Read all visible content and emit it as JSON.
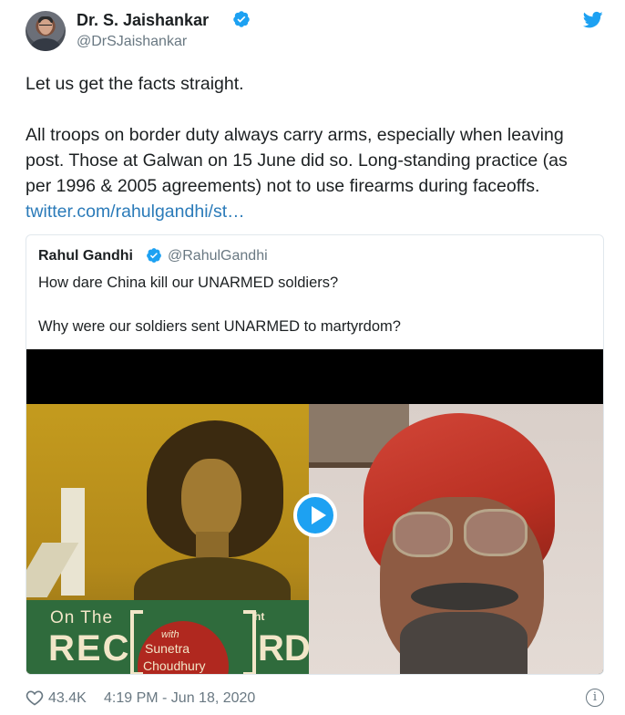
{
  "author": {
    "name": "Dr. S. Jaishankar",
    "handle": "@DrSJaishankar"
  },
  "tweet": {
    "line1": "Let us get the facts straight.",
    "line2": "All troops on border duty always carry arms, especially when leaving",
    "line3": "post. Those at Galwan on 15 June did so. Long-standing practice (as",
    "line4": "per 1996 & 2005 agreements) not to use firearms during faceoffs.",
    "link": "twitter.com/rahulgandhi/st…"
  },
  "quoted": {
    "name": "Rahul Gandhi",
    "handle": "@RahulGandhi",
    "line1": "How dare China kill our UNARMED soldiers?",
    "line2": "Why were our soldiers sent UNARMED to martyrdom?",
    "video_overlay": {
      "on_the": "On The",
      "rec": "REC",
      "with": "with",
      "sunetra": "Sunetra",
      "chaudhury": "Choudhury",
      "ht": "ht",
      "rd": "RD"
    }
  },
  "footer": {
    "likes": "43.4K",
    "timestamp": "4:19 PM - Jun 18, 2020"
  },
  "colors": {
    "link": "#2b7bb9",
    "twitter_blue": "#1da1f2",
    "meta_gray": "#697882"
  },
  "icons": [
    "verified-badge-icon",
    "twitter-bird-icon",
    "play-icon",
    "heart-icon",
    "info-icon"
  ]
}
